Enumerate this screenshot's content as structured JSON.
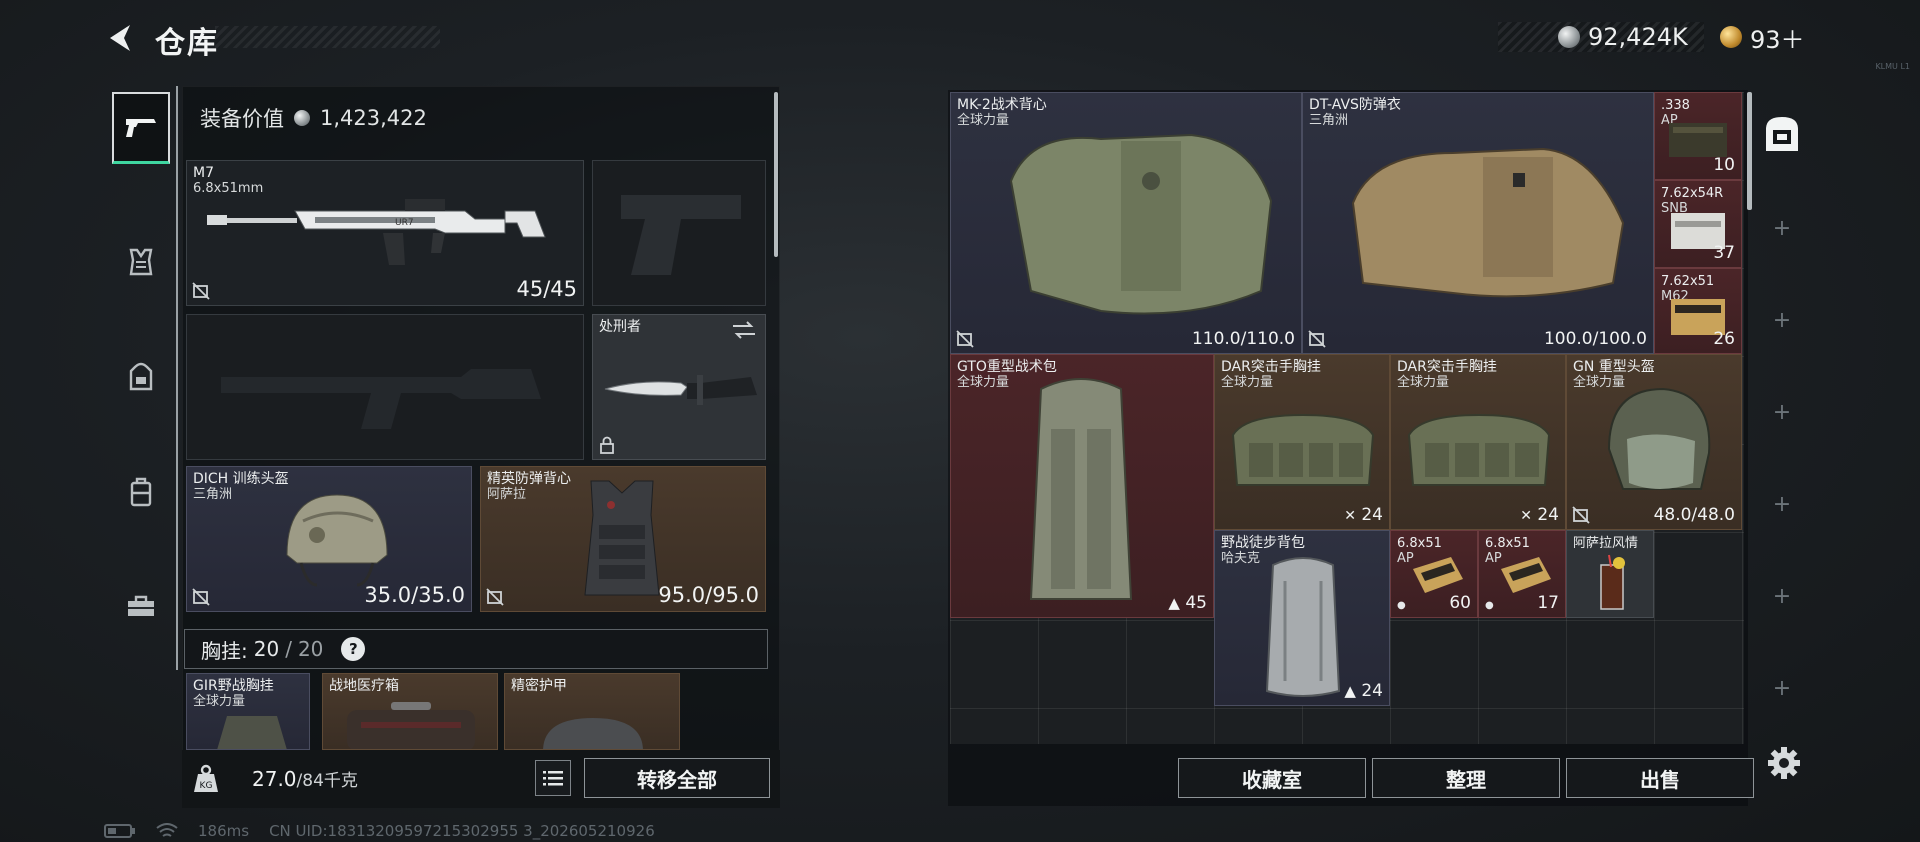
{
  "header": {
    "title": "仓库"
  },
  "currency": {
    "silver": "92,424K",
    "gold": "93＋",
    "tag": "KLMU L1"
  },
  "left": {
    "equip_value_label": "装备价值",
    "equip_value": "1,423,422",
    "primary_weapon": {
      "name": "M7",
      "caliber": "6.8x51mm",
      "ammo": "45/45"
    },
    "melee": {
      "name": "处刑者"
    },
    "helmet": {
      "name": "DICH 训练头盔",
      "origin": "三角洲",
      "durability": "35.0/35.0"
    },
    "armor": {
      "name": "精英防弹背心",
      "origin": "阿萨拉",
      "durability": "95.0/95.0"
    },
    "vest_bar": {
      "label": "胸挂:",
      "used": "20",
      "sep": "/",
      "total": "20",
      "help": "?"
    },
    "vest_items": [
      {
        "name": "GIR野战胸挂",
        "origin": "全球力量"
      },
      {
        "name": "战地医疗箱",
        "origin": ""
      },
      {
        "name": "精密护甲",
        "origin": ""
      }
    ],
    "weight": {
      "current": "27.0",
      "max": "/84千克"
    },
    "transfer_all": "转移全部"
  },
  "status": {
    "latency": "186ms",
    "uid": "CN UID:18313209597215302955 3_202605210926"
  },
  "stash": {
    "items": [
      {
        "name": "MK-2战术背心",
        "origin": "全球力量",
        "value": "110.0/110.0"
      },
      {
        "name": "DT-AVS防弹衣",
        "origin": "三角洲",
        "value": "100.0/100.0"
      },
      {
        "name": ".338",
        "origin": "AP",
        "value": "10"
      },
      {
        "name": "7.62x54R",
        "origin": "SNB",
        "value": "37"
      },
      {
        "name": "7.62x51",
        "origin": "M62",
        "value": "26"
      },
      {
        "name": "GTO重型战术包",
        "origin": "全球力量",
        "value": "45"
      },
      {
        "name": "DAR突击手胸挂",
        "origin": "全球力量",
        "value": "24"
      },
      {
        "name": "DAR突击手胸挂",
        "origin": "全球力量",
        "value": "24"
      },
      {
        "name": "GN 重型头盔",
        "origin": "全球力量",
        "value": "48.0/48.0"
      },
      {
        "name": "野战徒步背包",
        "origin": "哈夫克",
        "value": "24"
      },
      {
        "name": "6.8x51",
        "origin": "AP",
        "value": "60"
      },
      {
        "name": "6.8x51",
        "origin": "AP",
        "value": "17"
      },
      {
        "name": "阿萨拉风情",
        "origin": "",
        "value": ""
      }
    ],
    "buttons": {
      "collection": "收藏室",
      "organize": "整理",
      "sell": "出售"
    }
  },
  "colors": {
    "accent_green": "#3fd6a0",
    "rarity_red": "#4b2528",
    "rarity_brown": "#4a3a2c",
    "rarity_purple": "#2e3140"
  },
  "icons": [
    "back-arrow-icon",
    "silver-coin-icon",
    "gold-coin-icon",
    "pistol-icon",
    "vest-icon",
    "backpack-icon",
    "case-icon",
    "toolbox-icon",
    "lock-icon",
    "swap-icon",
    "no-insure-icon",
    "weight-icon",
    "list-icon",
    "gear-icon",
    "safe-box-icon",
    "plus-icon",
    "battery-icon",
    "wifi-icon"
  ]
}
